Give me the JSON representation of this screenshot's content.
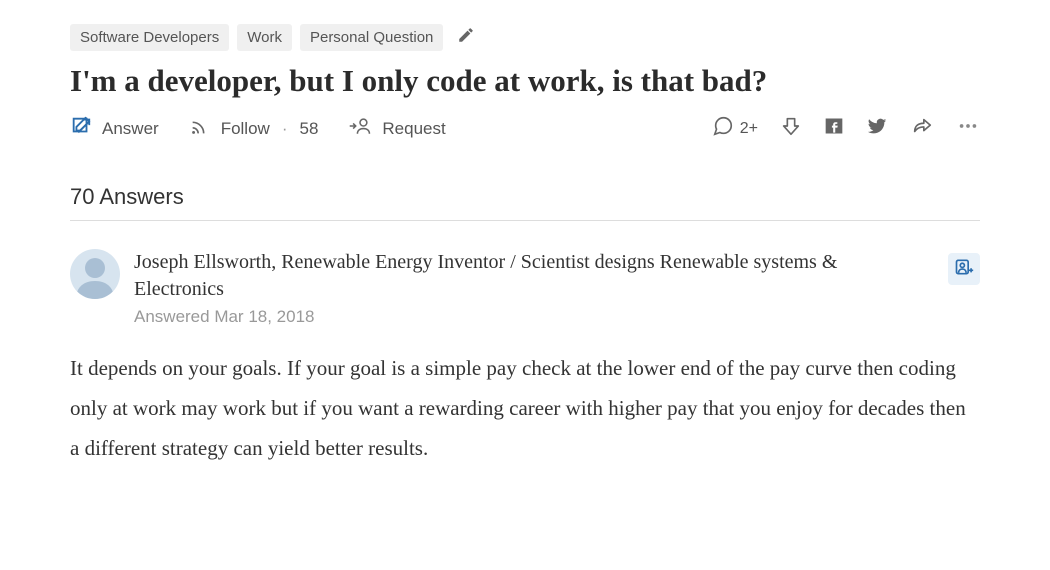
{
  "topics": [
    "Software Developers",
    "Work",
    "Personal Question"
  ],
  "question": {
    "title": "I'm a developer, but I only code at work, is that bad?"
  },
  "actions": {
    "answer": "Answer",
    "follow": "Follow",
    "follow_count": "58",
    "request": "Request",
    "comment_count": "2+"
  },
  "answers_header": "70 Answers",
  "answer": {
    "author_name": "Joseph Ellsworth",
    "author_bio": "Renewable Energy Inventor / Scientist designs Renewable systems & Electronics",
    "answered": "Answered Mar 18, 2018",
    "body": "It depends on your goals. If your goal is a simple pay check at the lower end of the pay curve then coding only at work may work but if you want a rewarding career with higher pay that you enjoy for decades then a different strategy can yield better results."
  }
}
